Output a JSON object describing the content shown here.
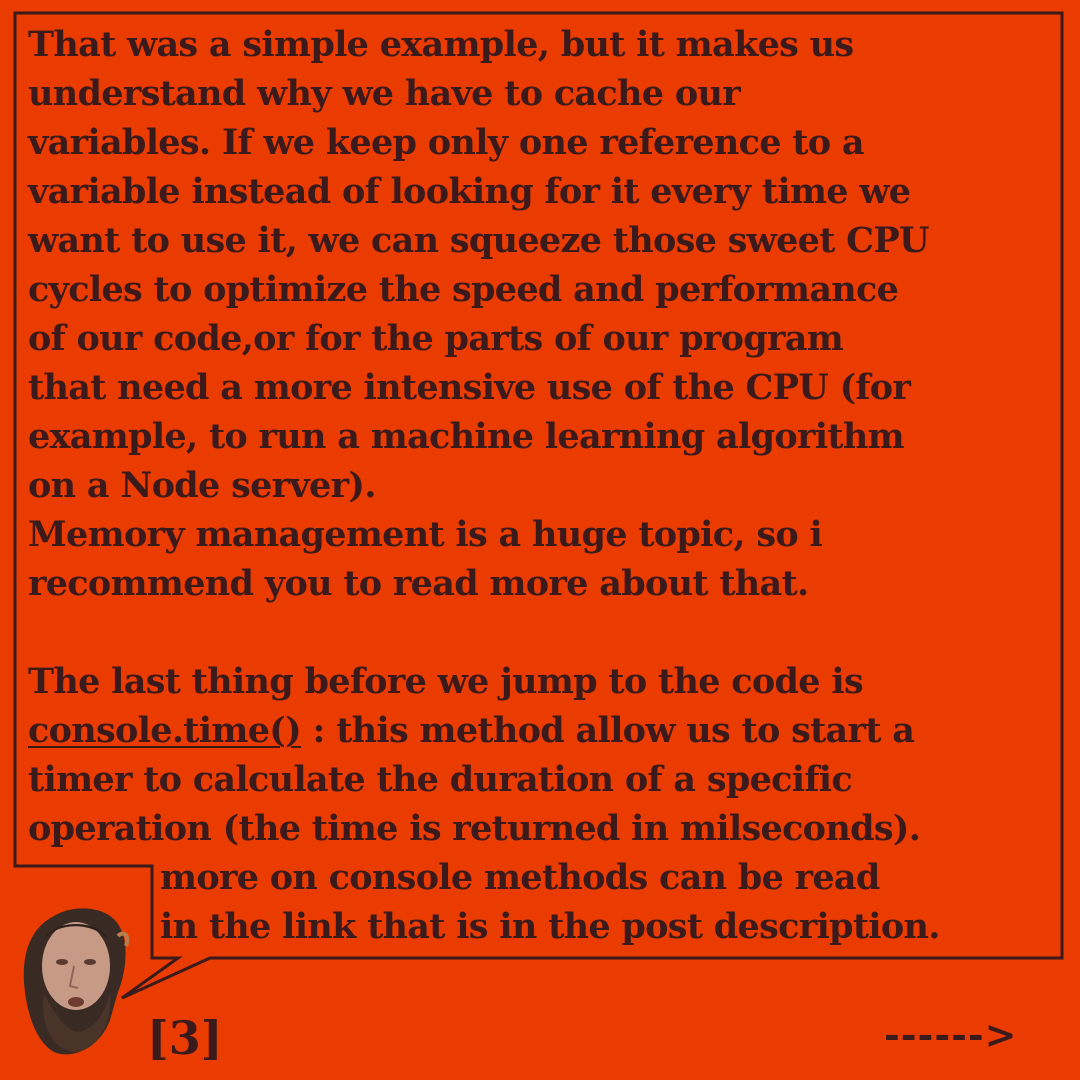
{
  "colors": {
    "background": "#ea3b00",
    "text": "#3b1a1c",
    "bubble_border": "#3b1a1c"
  },
  "bubble": {
    "paragraph1": [
      "That was a simple example, but it makes us",
      "understand why we have to cache our",
      "variables. If we keep only one reference to a",
      "variable instead of looking for it every time we",
      "want to use it, we can squeeze those sweet CPU",
      "cycles to optimize the speed and performance",
      "of our code,or for the parts of our program",
      "that need a more intensive use of the CPU (for",
      "example, to run a machine learning algorithm",
      "on a Node server)."
    ],
    "paragraph2": [
      "Memory management is a huge topic, so i",
      "recommend you to read more about that."
    ],
    "paragraph3": {
      "line1": "The last thing before we jump to the code is",
      "link": "console.time()",
      "line2_rest": " : this method allow us to start a",
      "line3": "timer to calculate the duration of a specific",
      "line4": "operation (the time is returned in milseconds)."
    },
    "paragraph4": [
      "more on console methods can be read",
      "in the link that is in the post description."
    ]
  },
  "avatar": {
    "icon": "author-avatar-icon"
  },
  "footer": {
    "page_number": "[3]",
    "next_arrow": "------>"
  }
}
